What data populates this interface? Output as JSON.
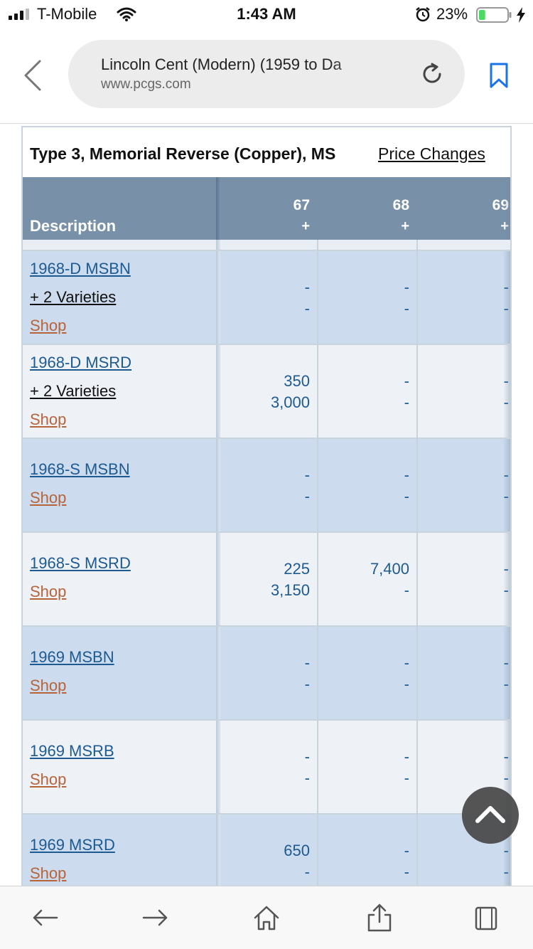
{
  "status_bar": {
    "carrier": "T-Mobile",
    "time": "1:43 AM",
    "battery_percent": "23%",
    "battery_level": 0.23,
    "icons": [
      "signal-icon",
      "wifi-icon",
      "alarm-icon",
      "battery-icon",
      "charging-bolt-icon"
    ]
  },
  "browser": {
    "page_title": "Lincoln Cent (Modern) (1959 to Da",
    "domain": "www.pcgs.com",
    "icons": [
      "back-chevron-icon",
      "reload-icon",
      "bookmark-icon"
    ]
  },
  "table": {
    "title": "Type 3, Memorial Reverse (Copper), MS",
    "price_changes_label": "Price Changes",
    "header": {
      "description_label": "Description",
      "columns": [
        {
          "grade": "67",
          "plus": "+"
        },
        {
          "grade": "68",
          "plus": "+"
        },
        {
          "grade": "69",
          "plus": "+"
        }
      ]
    },
    "rows": [
      {
        "name": "1968-D MSBN",
        "varieties": "+ 2 Varieties",
        "shop": "Shop",
        "values": [
          [
            "-",
            "-"
          ],
          [
            "-",
            "-"
          ],
          [
            "-",
            "-"
          ]
        ]
      },
      {
        "name": "1968-D MSRD",
        "varieties": "+ 2 Varieties",
        "shop": "Shop",
        "values": [
          [
            "350",
            "3,000"
          ],
          [
            "-",
            "-"
          ],
          [
            "-",
            "-"
          ]
        ]
      },
      {
        "name": "1968-S MSBN",
        "varieties": "",
        "shop": "Shop",
        "values": [
          [
            "-",
            "-"
          ],
          [
            "-",
            "-"
          ],
          [
            "-",
            "-"
          ]
        ]
      },
      {
        "name": "1968-S MSRD",
        "varieties": "",
        "shop": "Shop",
        "values": [
          [
            "225",
            "3,150"
          ],
          [
            "7,400",
            "-"
          ],
          [
            "-",
            "-"
          ]
        ]
      },
      {
        "name": "1969 MSBN",
        "varieties": "",
        "shop": "Shop",
        "values": [
          [
            "-",
            "-"
          ],
          [
            "-",
            "-"
          ],
          [
            "-",
            "-"
          ]
        ]
      },
      {
        "name": "1969 MSRB",
        "varieties": "",
        "shop": "Shop",
        "values": [
          [
            "-",
            "-"
          ],
          [
            "-",
            "-"
          ],
          [
            "-",
            "-"
          ]
        ]
      },
      {
        "name": "1969 MSRD",
        "varieties": "",
        "shop": "Shop",
        "values": [
          [
            "650",
            "-"
          ],
          [
            "-",
            "-"
          ],
          [
            "-",
            "-"
          ]
        ]
      }
    ]
  },
  "toolbar": {
    "icons": [
      "back-arrow-icon",
      "forward-arrow-icon",
      "home-icon",
      "share-icon",
      "tabs-icon"
    ]
  },
  "colors": {
    "header_bg": "#7890a8",
    "row_blue": "#ccdcee",
    "row_light": "#eef2f7",
    "link_blue": "#1d5a92",
    "shop_orange": "#b8643a"
  }
}
